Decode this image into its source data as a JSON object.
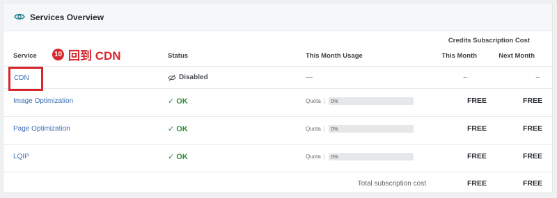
{
  "card": {
    "title": "Services Overview",
    "header_icon": "eye-icon"
  },
  "table": {
    "super_header": "Credits Subscription Cost",
    "columns": {
      "service": "Service",
      "status": "Status",
      "usage": "This Month Usage",
      "this_month": "This Month",
      "next_month": "Next Month"
    },
    "rows": [
      {
        "service": "CDN",
        "status": "Disabled",
        "status_icon": "eye-slash-icon",
        "usage": "—",
        "this_month": "–",
        "next_month": "–"
      },
      {
        "service": "Image Optimization",
        "status": "OK",
        "status_icon": "check-icon",
        "quota_label": "Quota",
        "quota_value": "0%",
        "quota_fraction": 0,
        "this_month": "FREE",
        "next_month": "FREE"
      },
      {
        "service": "Page Optimization",
        "status": "OK",
        "status_icon": "check-icon",
        "quota_label": "Quota",
        "quota_value": "0%",
        "quota_fraction": 0,
        "this_month": "FREE",
        "next_month": "FREE"
      },
      {
        "service": "LQIP",
        "status": "OK",
        "status_icon": "check-icon",
        "quota_label": "Quota",
        "quota_value": "0%",
        "quota_fraction": 0,
        "this_month": "FREE",
        "next_month": "FREE"
      }
    ],
    "total": {
      "label": "Total subscription cost",
      "this_month": "FREE",
      "next_month": "FREE"
    }
  },
  "annotation": {
    "number": "10",
    "text": "回到 CDN",
    "color": "#d7262c"
  },
  "colors": {
    "link": "#3a6fb3",
    "ok": "#2e8b3a",
    "highlight": "#d7262c"
  }
}
